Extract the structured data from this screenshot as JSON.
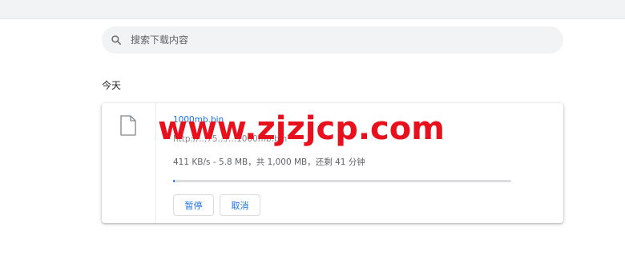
{
  "search": {
    "placeholder": "搜索下载内容"
  },
  "date_header": "今天",
  "download": {
    "file_name": "1000mb.bin",
    "url": "http://...75.../...1000mb.bin",
    "status": "411 KB/s - 5.8 MB，共 1,000 MB，还剩 41 分钟",
    "progress": 0.0058,
    "pause_label": "暂停",
    "cancel_label": "取消"
  },
  "watermark": "www.zjzjcp.com",
  "colors": {
    "accent": "#1a73e8",
    "watermark": "#e8101c"
  }
}
